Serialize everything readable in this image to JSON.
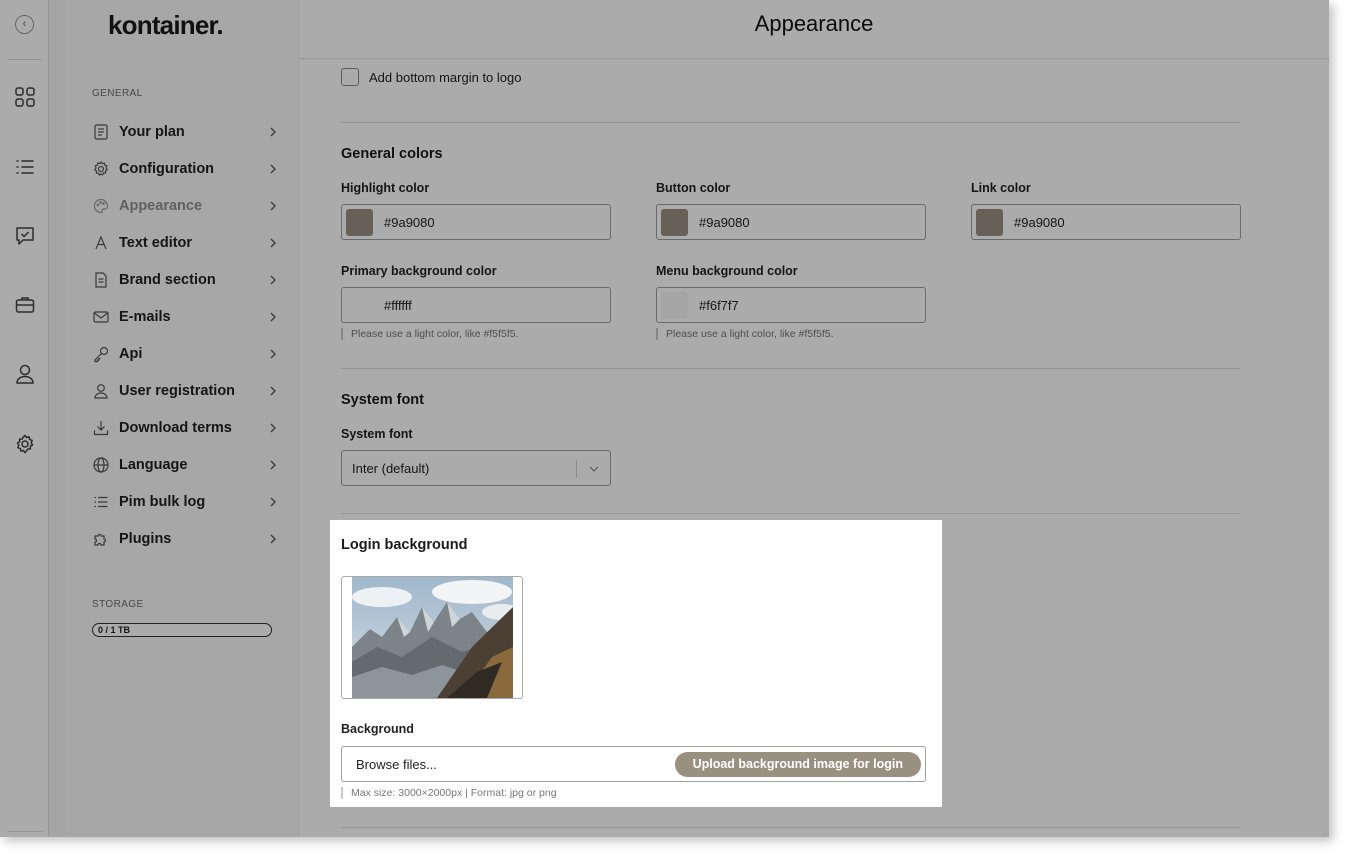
{
  "sidebar": {
    "logo": "kontainer.",
    "general_label": "GENERAL",
    "storage_label": "STORAGE",
    "storage_value": "0 / 1 TB",
    "items": [
      {
        "label": "Your plan",
        "icon": "plan-icon"
      },
      {
        "label": "Configuration",
        "icon": "gear-icon"
      },
      {
        "label": "Appearance",
        "icon": "palette-icon",
        "active": true
      },
      {
        "label": "Text editor",
        "icon": "text-icon"
      },
      {
        "label": "Brand section",
        "icon": "document-icon"
      },
      {
        "label": "E-mails",
        "icon": "mail-icon"
      },
      {
        "label": "Api",
        "icon": "key-icon"
      },
      {
        "label": "User registration",
        "icon": "user-icon"
      },
      {
        "label": "Download terms",
        "icon": "download-icon"
      },
      {
        "label": "Language",
        "icon": "globe-icon"
      },
      {
        "label": "Pim bulk log",
        "icon": "list-icon"
      },
      {
        "label": "Plugins",
        "icon": "puzzle-icon"
      }
    ]
  },
  "header": {
    "title": "Appearance"
  },
  "logo_options": {
    "bottom_margin_label": "Add bottom margin to logo",
    "checked": false
  },
  "general_colors": {
    "title": "General colors",
    "highlight": {
      "label": "Highlight color",
      "value": "#9a9080"
    },
    "button": {
      "label": "Button color",
      "value": "#9a9080"
    },
    "link": {
      "label": "Link color",
      "value": "#9a9080"
    },
    "primary_bg": {
      "label": "Primary background color",
      "value": "#ffffff",
      "hint": "Please use a light color, like #f5f5f5."
    },
    "menu_bg": {
      "label": "Menu background color",
      "value": "#f6f7f7",
      "hint": "Please use a light color, like #f5f5f5."
    }
  },
  "system_font": {
    "title": "System font",
    "label": "System font",
    "value": "Inter (default)"
  },
  "login_background": {
    "title": "Login background",
    "background_label": "Background",
    "file_placeholder": "Browse files...",
    "upload_button": "Upload background image for login",
    "hint": "Max size: 3000×2000px | Format: jpg or png"
  },
  "colors": {
    "accent": "#9a9080",
    "overlay": "rgba(0,0,0,0.33)"
  }
}
